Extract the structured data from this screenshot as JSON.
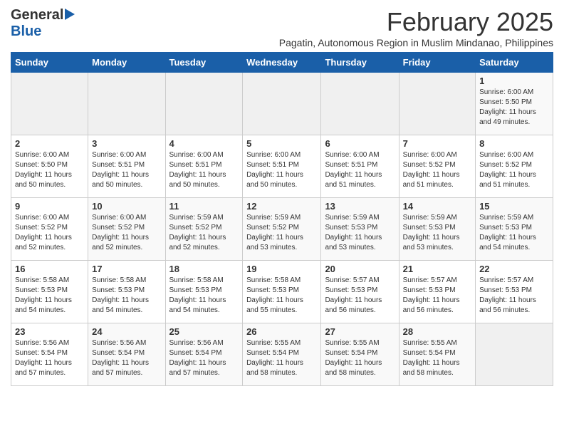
{
  "header": {
    "logo": {
      "general": "General",
      "blue": "Blue"
    },
    "title": "February 2025",
    "subtitle": "Pagatin, Autonomous Region in Muslim Mindanao, Philippines"
  },
  "weekdays": [
    "Sunday",
    "Monday",
    "Tuesday",
    "Wednesday",
    "Thursday",
    "Friday",
    "Saturday"
  ],
  "weeks": [
    {
      "days": [
        {
          "num": "",
          "info": ""
        },
        {
          "num": "",
          "info": ""
        },
        {
          "num": "",
          "info": ""
        },
        {
          "num": "",
          "info": ""
        },
        {
          "num": "",
          "info": ""
        },
        {
          "num": "",
          "info": ""
        },
        {
          "num": "1",
          "info": "Sunrise: 6:00 AM\nSunset: 5:50 PM\nDaylight: 11 hours\nand 49 minutes."
        }
      ]
    },
    {
      "days": [
        {
          "num": "2",
          "info": "Sunrise: 6:00 AM\nSunset: 5:50 PM\nDaylight: 11 hours\nand 50 minutes."
        },
        {
          "num": "3",
          "info": "Sunrise: 6:00 AM\nSunset: 5:51 PM\nDaylight: 11 hours\nand 50 minutes."
        },
        {
          "num": "4",
          "info": "Sunrise: 6:00 AM\nSunset: 5:51 PM\nDaylight: 11 hours\nand 50 minutes."
        },
        {
          "num": "5",
          "info": "Sunrise: 6:00 AM\nSunset: 5:51 PM\nDaylight: 11 hours\nand 50 minutes."
        },
        {
          "num": "6",
          "info": "Sunrise: 6:00 AM\nSunset: 5:51 PM\nDaylight: 11 hours\nand 51 minutes."
        },
        {
          "num": "7",
          "info": "Sunrise: 6:00 AM\nSunset: 5:52 PM\nDaylight: 11 hours\nand 51 minutes."
        },
        {
          "num": "8",
          "info": "Sunrise: 6:00 AM\nSunset: 5:52 PM\nDaylight: 11 hours\nand 51 minutes."
        }
      ]
    },
    {
      "days": [
        {
          "num": "9",
          "info": "Sunrise: 6:00 AM\nSunset: 5:52 PM\nDaylight: 11 hours\nand 52 minutes."
        },
        {
          "num": "10",
          "info": "Sunrise: 6:00 AM\nSunset: 5:52 PM\nDaylight: 11 hours\nand 52 minutes."
        },
        {
          "num": "11",
          "info": "Sunrise: 5:59 AM\nSunset: 5:52 PM\nDaylight: 11 hours\nand 52 minutes."
        },
        {
          "num": "12",
          "info": "Sunrise: 5:59 AM\nSunset: 5:52 PM\nDaylight: 11 hours\nand 53 minutes."
        },
        {
          "num": "13",
          "info": "Sunrise: 5:59 AM\nSunset: 5:53 PM\nDaylight: 11 hours\nand 53 minutes."
        },
        {
          "num": "14",
          "info": "Sunrise: 5:59 AM\nSunset: 5:53 PM\nDaylight: 11 hours\nand 53 minutes."
        },
        {
          "num": "15",
          "info": "Sunrise: 5:59 AM\nSunset: 5:53 PM\nDaylight: 11 hours\nand 54 minutes."
        }
      ]
    },
    {
      "days": [
        {
          "num": "16",
          "info": "Sunrise: 5:58 AM\nSunset: 5:53 PM\nDaylight: 11 hours\nand 54 minutes."
        },
        {
          "num": "17",
          "info": "Sunrise: 5:58 AM\nSunset: 5:53 PM\nDaylight: 11 hours\nand 54 minutes."
        },
        {
          "num": "18",
          "info": "Sunrise: 5:58 AM\nSunset: 5:53 PM\nDaylight: 11 hours\nand 54 minutes."
        },
        {
          "num": "19",
          "info": "Sunrise: 5:58 AM\nSunset: 5:53 PM\nDaylight: 11 hours\nand 55 minutes."
        },
        {
          "num": "20",
          "info": "Sunrise: 5:57 AM\nSunset: 5:53 PM\nDaylight: 11 hours\nand 56 minutes."
        },
        {
          "num": "21",
          "info": "Sunrise: 5:57 AM\nSunset: 5:53 PM\nDaylight: 11 hours\nand 56 minutes."
        },
        {
          "num": "22",
          "info": "Sunrise: 5:57 AM\nSunset: 5:53 PM\nDaylight: 11 hours\nand 56 minutes."
        }
      ]
    },
    {
      "days": [
        {
          "num": "23",
          "info": "Sunrise: 5:56 AM\nSunset: 5:54 PM\nDaylight: 11 hours\nand 57 minutes."
        },
        {
          "num": "24",
          "info": "Sunrise: 5:56 AM\nSunset: 5:54 PM\nDaylight: 11 hours\nand 57 minutes."
        },
        {
          "num": "25",
          "info": "Sunrise: 5:56 AM\nSunset: 5:54 PM\nDaylight: 11 hours\nand 57 minutes."
        },
        {
          "num": "26",
          "info": "Sunrise: 5:55 AM\nSunset: 5:54 PM\nDaylight: 11 hours\nand 58 minutes."
        },
        {
          "num": "27",
          "info": "Sunrise: 5:55 AM\nSunset: 5:54 PM\nDaylight: 11 hours\nand 58 minutes."
        },
        {
          "num": "28",
          "info": "Sunrise: 5:55 AM\nSunset: 5:54 PM\nDaylight: 11 hours\nand 58 minutes."
        },
        {
          "num": "",
          "info": ""
        }
      ]
    }
  ]
}
